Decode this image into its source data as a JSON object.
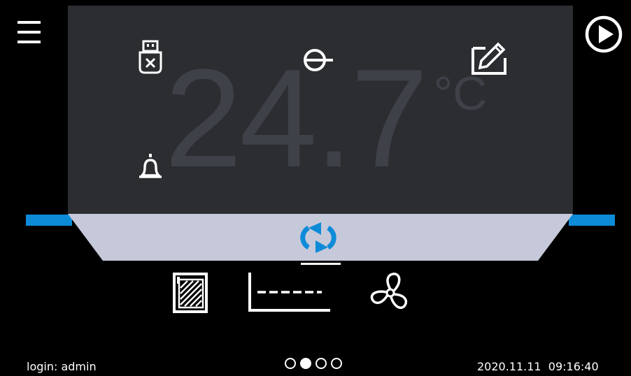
{
  "display": {
    "temperature": "24.7",
    "unit": "°C"
  },
  "icons": {
    "menu": "hamburger-menu-icon",
    "play": "play-icon",
    "usb": "usb-disconnected-icon",
    "login": "key-login-icon",
    "edit": "edit-icon",
    "alarm": "bell-icon",
    "sync": "sync-icon",
    "door": "chamber-door-icon",
    "chart": "chart-icon",
    "fan": "fan-icon"
  },
  "footer": {
    "login": "login: admin",
    "datetime": "2020.11.11  09:16:40",
    "pages_total": 4,
    "current_page": 2
  },
  "colors": {
    "accent": "#0e8bd8",
    "panel": "#2b2d31",
    "tray": "#c6c9da",
    "temperature": "#3e4148"
  }
}
